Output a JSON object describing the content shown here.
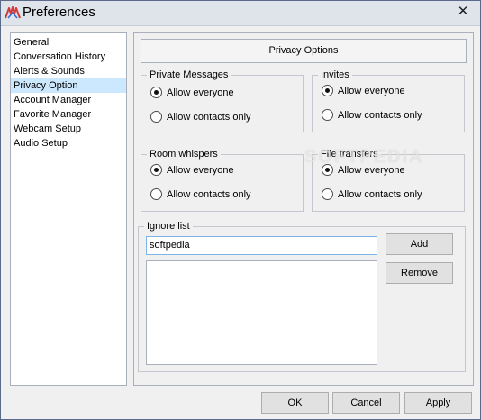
{
  "window": {
    "title": "Preferences",
    "close_glyph": "✕"
  },
  "sidebar": {
    "items": [
      {
        "label": "General"
      },
      {
        "label": "Conversation History"
      },
      {
        "label": "Alerts & Sounds"
      },
      {
        "label": "Privacy Option",
        "selected": true
      },
      {
        "label": "Account Manager"
      },
      {
        "label": "Favorite Manager"
      },
      {
        "label": "Webcam Setup"
      },
      {
        "label": "Audio Setup"
      }
    ]
  },
  "panel": {
    "header": "Privacy Options",
    "private_messages": {
      "legend": "Private Messages",
      "options": [
        "Allow everyone",
        "Allow contacts only"
      ],
      "selected": "Allow everyone"
    },
    "invites": {
      "legend": "Invites",
      "options": [
        "Allow everyone",
        "Allow contacts only"
      ],
      "selected": "Allow everyone"
    },
    "room_whispers": {
      "legend": "Room whispers",
      "options": [
        "Allow everyone",
        "Allow contacts only"
      ],
      "selected": "Allow everyone"
    },
    "file_transfers": {
      "legend": "File transfers",
      "options": [
        "Allow everyone",
        "Allow contacts only"
      ],
      "selected": "Allow everyone"
    },
    "ignore_list": {
      "legend": "Ignore list",
      "input_value": "softpedia",
      "entries": [],
      "add_label": "Add",
      "remove_label": "Remove"
    }
  },
  "footer": {
    "ok_label": "OK",
    "cancel_label": "Cancel",
    "apply_label": "Apply"
  },
  "watermark": "SOFTPEDIA",
  "colors": {
    "selection": "#cce8ff",
    "input_focus_border": "#7eb4ea",
    "window_bg": "#f0f0f0"
  }
}
